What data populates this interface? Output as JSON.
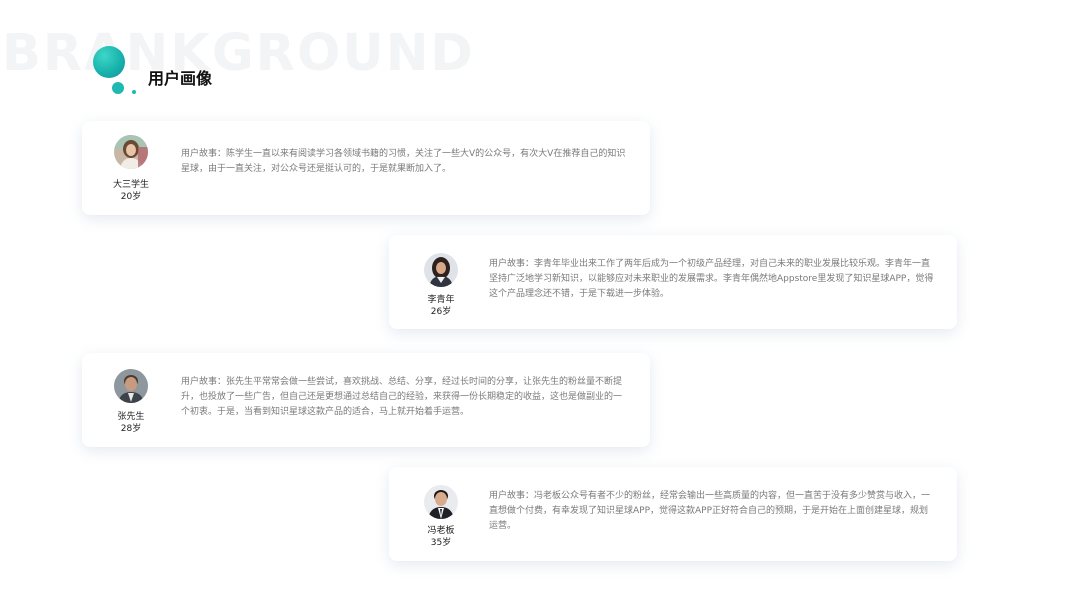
{
  "background_word": "BRANKGROUND",
  "page_title": "用户画像",
  "colors": {
    "accent": "#1fb9b1",
    "accent_light": "#3ed6c8",
    "text_dark": "#111111",
    "text_body": "#7a7a7a",
    "watermark": "#f3f4f5"
  },
  "personas": [
    {
      "name": "大三学生",
      "age": "20岁",
      "avatar_icon": "woman-portrait-icon",
      "story": "用户故事：陈学生一直以来有阅读学习各领域书籍的习惯，关注了一些大V的公众号，有次大V在推荐自己的知识星球，由于一直关注，对公众号还是挺认可的，于是就果断加入了。"
    },
    {
      "name": "李青年",
      "age": "26岁",
      "avatar_icon": "woman-portrait-icon",
      "story": "用户故事：李青年毕业出来工作了两年后成为一个初级产品经理，对自己未来的职业发展比较乐观。李青年一直坚持广泛地学习新知识，以能够应对未来职业的发展需求。李青年偶然地Appstore里发现了知识星球APP，觉得这个产品理念还不错，于是下载进一步体验。"
    },
    {
      "name": "张先生",
      "age": "28岁",
      "avatar_icon": "man-portrait-icon",
      "story": "用户故事：张先生平常常会做一些尝试，喜欢挑战、总结、分享，经过长时间的分享，让张先生的粉丝量不断提升，也投放了一些广告，但自己还是更想通过总结自己的经验，来获得一份长期稳定的收益，这也是做副业的一个初衷。于是，当看到知识星球这款产品的适合，马上就开始着手运营。"
    },
    {
      "name": "冯老板",
      "age": "35岁",
      "avatar_icon": "man-in-suit-portrait-icon",
      "story": "用户故事：冯老板公众号有者不少的粉丝，经常会输出一些高质量的内容，但一直苦于没有多少赞赏与收入，一直想做个付费，有幸发现了知识星球APP，觉得这款APP正好符合自己的预期，于是开始在上面创建星球，规划运营。"
    }
  ]
}
